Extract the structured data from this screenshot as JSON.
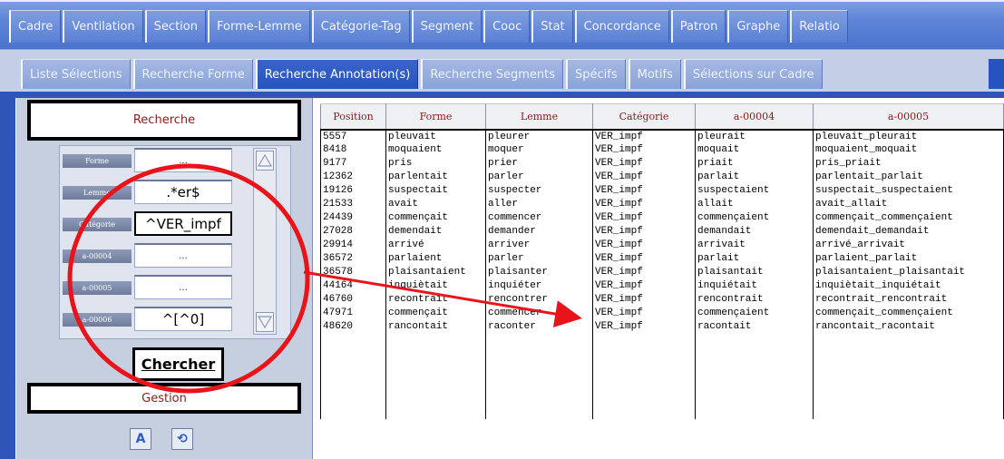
{
  "top_tabs": [
    {
      "label": "Cadre"
    },
    {
      "label": "Ventilation"
    },
    {
      "label": "Section"
    },
    {
      "label": "Forme-Lemme"
    },
    {
      "label": "Catégorie-Tag"
    },
    {
      "label": "Segment"
    },
    {
      "label": "Cooc"
    },
    {
      "label": "Stat"
    },
    {
      "label": "Concordance"
    },
    {
      "label": "Patron"
    },
    {
      "label": "Graphe"
    },
    {
      "label": "Relatio"
    }
  ],
  "sub_tabs": [
    {
      "label": "Liste Sélections"
    },
    {
      "label": "Recherche Forme"
    },
    {
      "label": "Recherche Annotation(s)"
    },
    {
      "label": "Recherche Segments"
    },
    {
      "label": "Spécifs"
    },
    {
      "label": "Motifs"
    },
    {
      "label": "Sélections sur Cadre"
    }
  ],
  "left_panel": {
    "title": "Recherche",
    "fields": [
      {
        "label": "Forme",
        "value": "..."
      },
      {
        "label": "Lemme",
        "value": ".*er$"
      },
      {
        "label": "Catégorie",
        "value": "^VER_impf"
      },
      {
        "label": "a-00004",
        "value": "..."
      },
      {
        "label": "a-00005",
        "value": "..."
      },
      {
        "label": "a-00006",
        "value": "^[^0]"
      }
    ],
    "search_button": "Chercher",
    "gestion_title": "Gestion",
    "gestion_icons": [
      "A",
      "⟲"
    ]
  },
  "table": {
    "columns": [
      "Position",
      "Forme",
      "Lemme",
      "Catégorie",
      "a-00004",
      "a-00005"
    ],
    "rows": [
      [
        "5557",
        "pleuvait",
        "pleurer",
        "VER_impf",
        "pleurait",
        "pleuvait_pleurait"
      ],
      [
        "8418",
        "moquaient",
        "moquer",
        "VER_impf",
        "moquait",
        "moquaient_moquait"
      ],
      [
        "9177",
        "pris",
        "prier",
        "VER_impf",
        "priait",
        "pris_priait"
      ],
      [
        "12362",
        "parlentait",
        "parler",
        "VER_impf",
        "parlait",
        "parlentait_parlait"
      ],
      [
        "19126",
        "suspectait",
        "suspecter",
        "VER_impf",
        "suspectaient",
        "suspectait_suspectaient"
      ],
      [
        "21533",
        "avait",
        "aller",
        "VER_impf",
        "allait",
        "avait_allait"
      ],
      [
        "24439",
        "commençait",
        "commencer",
        "VER_impf",
        "commençaient",
        "commençait_commençaient"
      ],
      [
        "27028",
        "demendait",
        "demander",
        "VER_impf",
        "demandait",
        "demendait_demandait"
      ],
      [
        "29914",
        "arrivé",
        "arriver",
        "VER_impf",
        "arrivait",
        "arrivé_arrivait"
      ],
      [
        "36572",
        "parlaient",
        "parler",
        "VER_impf",
        "parlait",
        "parlaient_parlait"
      ],
      [
        "36578",
        "plaisantaient",
        "plaisanter",
        "VER_impf",
        "plaisantait",
        "plaisantaient_plaisantait"
      ],
      [
        "44164",
        "inquiètait",
        "inquiéter",
        "VER_impf",
        "inquiétait",
        "inquiètait_inquiétait"
      ],
      [
        "46760",
        "recontrait",
        "rencontrer",
        "VER_impf",
        "rencontrait",
        "recontrait_rencontrait"
      ],
      [
        "47971",
        "commençait",
        "commencer",
        "VER_impf",
        "commençaient",
        "commençait_commençaient"
      ],
      [
        "48620",
        "rancontait",
        "raconter",
        "VER_impf",
        "racontait",
        "rancontait_racontait"
      ]
    ]
  },
  "colors": {
    "frame_blue": "#2f55b8",
    "header_red": "#8b1a1a",
    "annotation_red": "#e8141a"
  },
  "icons": {
    "scroll_up": "triangle-up-icon",
    "scroll_down": "triangle-down-icon"
  }
}
